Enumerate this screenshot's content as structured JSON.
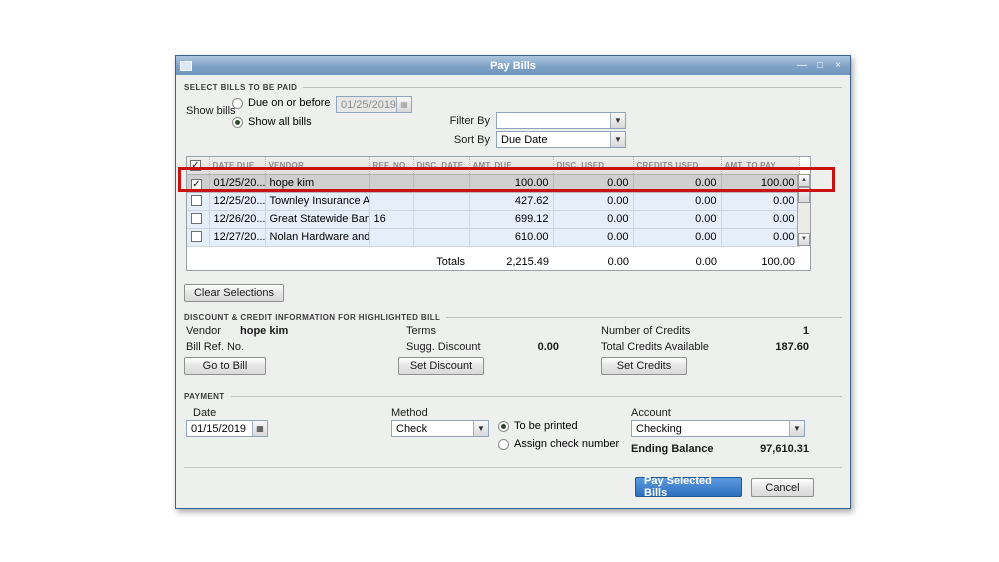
{
  "window": {
    "title": "Pay Bills"
  },
  "icons": {
    "minimize": "—",
    "maximize": "□",
    "close": "×",
    "dropdown": "▼",
    "calendar": "▦",
    "scroll_up": "▲",
    "scroll_down": "▼"
  },
  "select_bills": {
    "section_label": "SELECT BILLS TO BE PAID",
    "show_bills": "Show bills",
    "due_on_or_before": "Due on or before",
    "due_date": "01/25/2019",
    "show_all_bills": "Show all bills",
    "filter_by": "Filter By",
    "filter_value": "",
    "sort_by": "Sort By",
    "sort_value": "Due Date"
  },
  "table": {
    "header_check": "✓",
    "headers": [
      "DATE DUE",
      "VENDOR",
      "REF. NO.",
      "DISC. DATE",
      "AMT. DUE",
      "DISC. USED",
      "CREDITS USED",
      "AMT. TO PAY"
    ],
    "rows": [
      {
        "check": "✓",
        "date_due": "01/25/20...",
        "vendor": "hope kim",
        "ref_no": "",
        "disc_date": "",
        "amt_due": "100.00",
        "disc_used": "0.00",
        "credits_used": "0.00",
        "amt_to_pay": "100.00"
      },
      {
        "check": "",
        "date_due": "12/25/20...",
        "vendor": "Townley Insurance A...",
        "ref_no": "",
        "disc_date": "",
        "amt_due": "427.62",
        "disc_used": "0.00",
        "credits_used": "0.00",
        "amt_to_pay": "0.00"
      },
      {
        "check": "",
        "date_due": "12/26/20...",
        "vendor": "Great Statewide Bank",
        "ref_no": "16",
        "disc_date": "",
        "amt_due": "699.12",
        "disc_used": "0.00",
        "credits_used": "0.00",
        "amt_to_pay": "0.00"
      },
      {
        "check": "",
        "date_due": "12/27/20...",
        "vendor": "Nolan Hardware and ...",
        "ref_no": "",
        "disc_date": "",
        "amt_due": "610.00",
        "disc_used": "0.00",
        "credits_used": "0.00",
        "amt_to_pay": "0.00"
      }
    ],
    "totals_label": "Totals",
    "totals": {
      "amt_due": "2,215.49",
      "disc_used": "0.00",
      "credits_used": "0.00",
      "amt_to_pay": "100.00"
    }
  },
  "buttons": {
    "clear_selections": "Clear Selections",
    "go_to_bill": "Go to Bill",
    "set_discount": "Set Discount",
    "set_credits": "Set Credits",
    "pay_selected": "Pay Selected Bills",
    "cancel": "Cancel"
  },
  "discount_credit": {
    "section_label": "DISCOUNT & CREDIT INFORMATION FOR HIGHLIGHTED BILL",
    "vendor_label": "Vendor",
    "vendor_value": "hope kim",
    "bill_ref_label": "Bill Ref. No.",
    "bill_ref_value": "",
    "terms_label": "Terms",
    "terms_value": "",
    "sugg_discount_label": "Sugg. Discount",
    "sugg_discount_value": "0.00",
    "number_of_credits_label": "Number of Credits",
    "number_of_credits_value": "1",
    "total_credits_label": "Total Credits Available",
    "total_credits_value": "187.60"
  },
  "payment": {
    "section_label": "PAYMENT",
    "date_label": "Date",
    "date_value": "01/15/2019",
    "method_label": "Method",
    "method_value": "Check",
    "to_be_printed": "To be printed",
    "assign_check_number": "Assign check number",
    "account_label": "Account",
    "account_value": "Checking",
    "ending_balance_label": "Ending Balance",
    "ending_balance_value": "97,610.31"
  }
}
